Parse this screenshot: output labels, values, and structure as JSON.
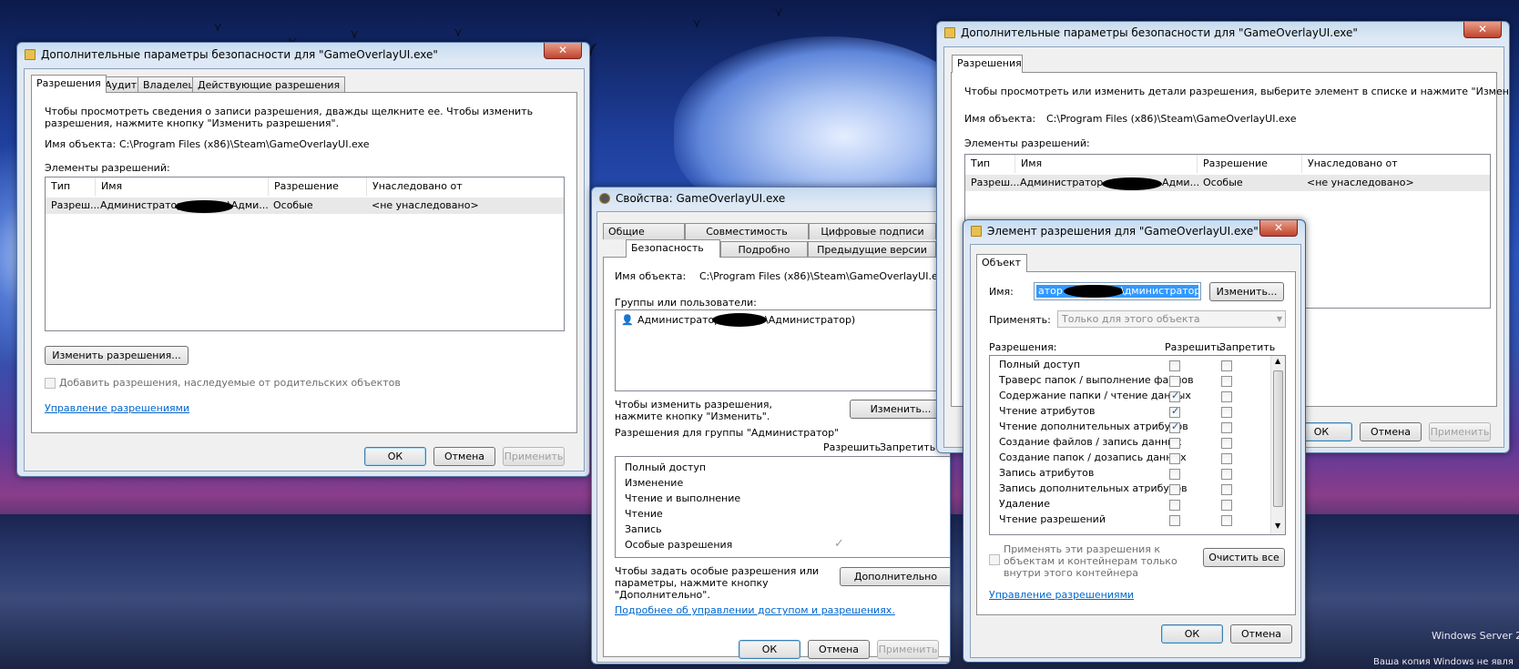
{
  "desktop": {
    "watermark1": "Windows Server 2",
    "watermark2": "Ваша копия Windows не явля"
  },
  "win1": {
    "title": "Дополнительные параметры безопасности  для \"GameOverlayUI.exe\"",
    "tabs": [
      "Разрешения",
      "Аудит",
      "Владелец",
      "Действующие разрешения"
    ],
    "info": "Чтобы просмотреть сведения о записи разрешения, дважды щелкните ее. Чтобы изменить разрешения, нажмите кнопку \"Изменить разрешения\".",
    "object_label": "Имя объекта:",
    "object_path": "C:\\Program Files (x86)\\Steam\\GameOverlayUI.exe",
    "entries_label": "Элементы разрешений:",
    "columns": [
      "Тип",
      "Имя",
      "Разрешение",
      "Унаследовано от"
    ],
    "row": {
      "type": "Разреш...",
      "name_a": "Администратор (",
      "name_b": "\\Адми...",
      "perm": "Особые",
      "inherited": "<не унаследовано>"
    },
    "change_button": "Изменить разрешения...",
    "inherit_checkbox": "Добавить разрешения, наследуемые от родительских объектов",
    "manage_link": "Управление разрешениями",
    "ok": "ОК",
    "cancel": "Отмена",
    "apply": "Применить"
  },
  "win2": {
    "title": "Свойства: GameOverlayUI.exe",
    "tabs_row1": [
      "Общие",
      "Совместимость",
      "Цифровые подписи"
    ],
    "tabs_row2": [
      "Безопасность",
      "Подробно",
      "Предыдущие версии"
    ],
    "object_label": "Имя объекта:",
    "object_path": "C:\\Program Files (x86)\\Steam\\GameOverlayUI.exe",
    "groups_label": "Группы или пользователи:",
    "user_a": "Администратор (",
    "user_b": "\\Администратор)",
    "change_hint": "Чтобы изменить разрешения, нажмите кнопку \"Изменить\".",
    "change_button": "Изменить...",
    "perm_label": "Разрешения для группы \"Администратор\"",
    "allow": "Разрешить",
    "deny": "Запретить",
    "perms": [
      "Полный доступ",
      "Изменение",
      "Чтение и выполнение",
      "Чтение",
      "Запись",
      "Особые разрешения"
    ],
    "advanced_hint": "Чтобы задать особые разрешения или параметры, нажмите кнопку \"Дополнительно\".",
    "advanced_button": "Дополнительно",
    "link": "Подробнее об управлении доступом и разрешениях.",
    "ok": "ОК",
    "cancel": "Отмена",
    "apply": "Применить"
  },
  "win3": {
    "title": "Дополнительные параметры безопасности  для \"GameOverlayUI.exe\"",
    "tab": "Разрешения",
    "info": "Чтобы просмотреть или изменить детали разрешения, выберите элемент в списке и нажмите \"Изменить\".",
    "object_label": "Имя объекта:",
    "object_path": "C:\\Program Files (x86)\\Steam\\GameOverlayUI.exe",
    "entries_label": "Элементы разрешений:",
    "columns": [
      "Тип",
      "Имя",
      "Разрешение",
      "Унаследовано от"
    ],
    "row": {
      "type": "Разреш...",
      "name_a": "Администратор",
      "name_b": "Адми...",
      "perm": "Особые",
      "inherited": "<не унаследовано>"
    },
    "ok": "ОК",
    "cancel": "Отмена",
    "apply": "Применить"
  },
  "win4": {
    "title": "Элемент разрешения для \"GameOverlayUI.exe\"",
    "tab": "Объект",
    "name_label": "Имя:",
    "name_a": "атор",
    "name_b": "\\дминистратор)",
    "change_button": "Изменить...",
    "apply_label": "Применять:",
    "apply_value": "Только для этого объекта",
    "perms_label": "Разрешения:",
    "allow": "Разрешить",
    "deny": "Запретить",
    "perms": [
      {
        "label": "Полный доступ",
        "allow": false
      },
      {
        "label": "Траверс папок / выполнение файлов",
        "allow": false
      },
      {
        "label": "Содержание папки / чтение данных",
        "allow": true
      },
      {
        "label": "Чтение атрибутов",
        "allow": true
      },
      {
        "label": "Чтение дополнительных атрибутов",
        "allow": true
      },
      {
        "label": "Создание файлов / запись данных",
        "allow": false
      },
      {
        "label": "Создание папок / дозапись данных",
        "allow": false
      },
      {
        "label": "Запись атрибутов",
        "allow": false
      },
      {
        "label": "Запись дополнительных атрибутов",
        "allow": false
      },
      {
        "label": "Удаление",
        "allow": false
      },
      {
        "label": "Чтение разрешений",
        "allow": false
      }
    ],
    "apply_checkbox": "Применять эти разрешения к объектам и контейнерам только внутри этого контейнера",
    "clear_button": "Очистить все",
    "manage_link": "Управление разрешениями",
    "ok": "ОК",
    "cancel": "Отмена"
  }
}
